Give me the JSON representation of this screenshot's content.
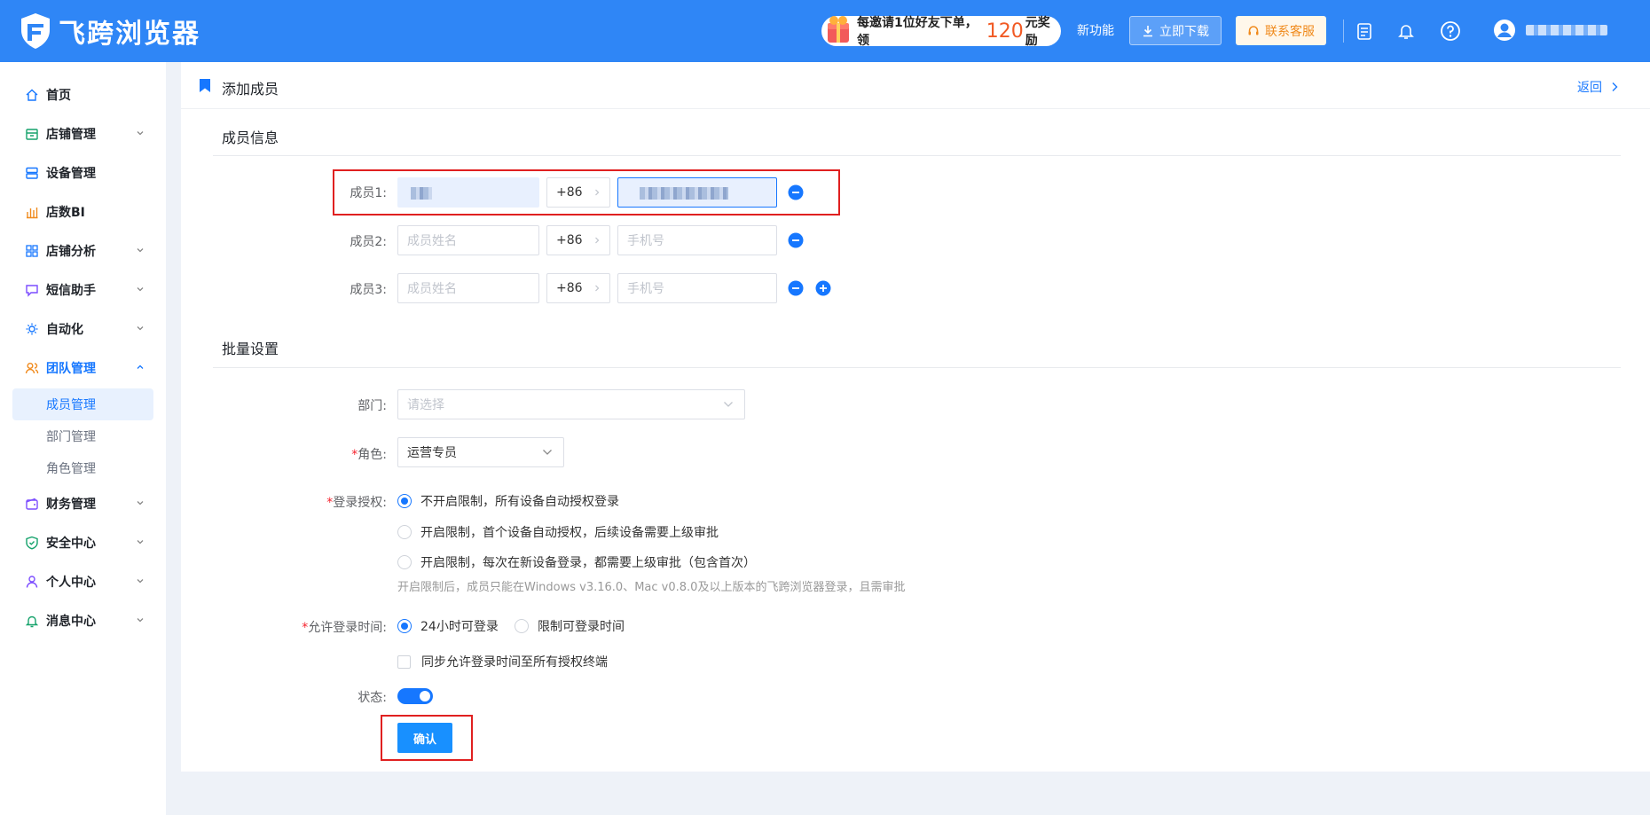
{
  "brand": {
    "name": "飞跨浏览器"
  },
  "topbar": {
    "promo_pre": "每邀请1位好友下单，领",
    "promo_num": "120",
    "promo_post": "元奖励",
    "new_feature": "新功能",
    "download": "立即下载",
    "support": "联系客服",
    "icons": [
      "doc-icon",
      "bell-icon",
      "help-icon",
      "user-icon"
    ]
  },
  "sidebar": {
    "items": [
      {
        "label": "首页",
        "icon": "home-icon"
      },
      {
        "label": "店铺管理",
        "icon": "store-icon"
      },
      {
        "label": "设备管理",
        "icon": "device-icon"
      },
      {
        "label": "店数BI",
        "icon": "chart-icon"
      },
      {
        "label": "店铺分析",
        "icon": "grid-icon"
      },
      {
        "label": "短信助手",
        "icon": "message-icon"
      },
      {
        "label": "自动化",
        "icon": "automation-icon"
      },
      {
        "label": "团队管理",
        "icon": "team-icon"
      },
      {
        "label": "财务管理",
        "icon": "wallet-icon"
      },
      {
        "label": "安全中心",
        "icon": "shield-icon"
      },
      {
        "label": "个人中心",
        "icon": "person-icon"
      },
      {
        "label": "消息中心",
        "icon": "bell-icon"
      }
    ],
    "team_sub": [
      {
        "label": "成员管理"
      },
      {
        "label": "部门管理"
      },
      {
        "label": "角色管理"
      }
    ]
  },
  "page": {
    "title": "添加成员",
    "back": "返回",
    "section_members": "成员信息",
    "section_batch": "批量设置"
  },
  "members": [
    {
      "label": "成员1:",
      "name_placeholder": "",
      "country_code": "+86",
      "phone_placeholder": ""
    },
    {
      "label": "成员2:",
      "name_placeholder": "成员姓名",
      "country_code": "+86",
      "phone_placeholder": "手机号"
    },
    {
      "label": "成员3:",
      "name_placeholder": "成员姓名",
      "country_code": "+86",
      "phone_placeholder": "手机号"
    }
  ],
  "form": {
    "dept_label": "部门:",
    "dept_placeholder": "请选择",
    "role_label": "角色:",
    "role_value": "运营专员",
    "auth_label": "登录授权:",
    "auth_options": [
      "不开启限制，所有设备自动授权登录",
      "开启限制，首个设备自动授权，后续设备需要上级审批",
      "开启限制，每次在新设备登录，都需要上级审批（包含首次）"
    ],
    "auth_hint": "开启限制后，成员只能在Windows v3.16.0、Mac v0.8.0及以上版本的飞跨浏览器登录，且需审批",
    "time_label": "允许登录时间:",
    "time_options": [
      "24小时可登录",
      "限制可登录时间"
    ],
    "sync_label": "同步允许登录时间至所有授权终端",
    "status_label": "状态:",
    "status_on": true,
    "confirm": "确认"
  },
  "colors": {
    "primary": "#2f86f6",
    "accent": "#1677ff",
    "highlight_box": "#e02020",
    "promo_number": "#f15a24",
    "support_text": "#f08a1c"
  }
}
